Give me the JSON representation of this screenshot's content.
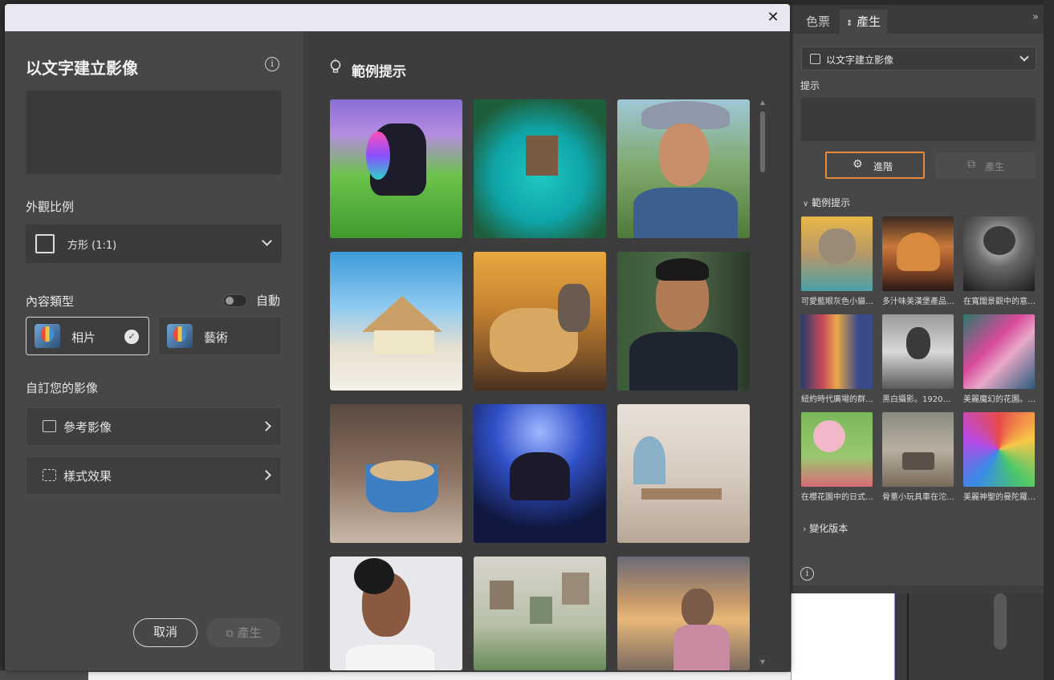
{
  "dialog": {
    "title": "以文字建立影像",
    "aspect_label": "外觀比例",
    "aspect_value": "方形 (1:1)",
    "content_type_label": "內容類型",
    "auto_label": "自動",
    "photo_label": "相片",
    "art_label": "藝術",
    "customize_label": "自訂您的影像",
    "reference_label": "參考影像",
    "style_label": "樣式效果",
    "cancel_label": "取消",
    "generate_label": "產生",
    "examples_title": "範例提示"
  },
  "example_thumbs": [
    {
      "name": "unicorn"
    },
    {
      "name": "island-hut"
    },
    {
      "name": "woman-hat"
    },
    {
      "name": "beach-hut"
    },
    {
      "name": "cheetah"
    },
    {
      "name": "man-portrait"
    },
    {
      "name": "latte"
    },
    {
      "name": "ballet"
    },
    {
      "name": "kitchen"
    },
    {
      "name": "woman-profile"
    },
    {
      "name": "plant-wall"
    },
    {
      "name": "beach-woman"
    }
  ],
  "panel": {
    "tab_swatches": "色票",
    "tab_generate": "產生",
    "dropdown_value": "以文字建立影像",
    "prompt_label": "提示",
    "advanced_label": "進階",
    "generate_label": "產生",
    "examples_label": "範例提示",
    "variations_label": "變化版本",
    "examples": [
      {
        "caption": "可愛藍眼灰色小貓…"
      },
      {
        "caption": "多汁味美漢堡產品…"
      },
      {
        "caption": "在寬闊景觀中的意…"
      },
      {
        "caption": "紐約時代廣場的群…"
      },
      {
        "caption": "黑白攝影。1920…"
      },
      {
        "caption": "美麗魔幻的花園。…"
      },
      {
        "caption": "在櫻花園中的日式…"
      },
      {
        "caption": "骨董小玩具車在沱…"
      },
      {
        "caption": "美麗神聖的曼陀羅…"
      }
    ]
  },
  "colors": {
    "accent_orange": "#e8883a",
    "dialog_bg": "#474747",
    "gallery_bg": "#3d3d3d"
  }
}
